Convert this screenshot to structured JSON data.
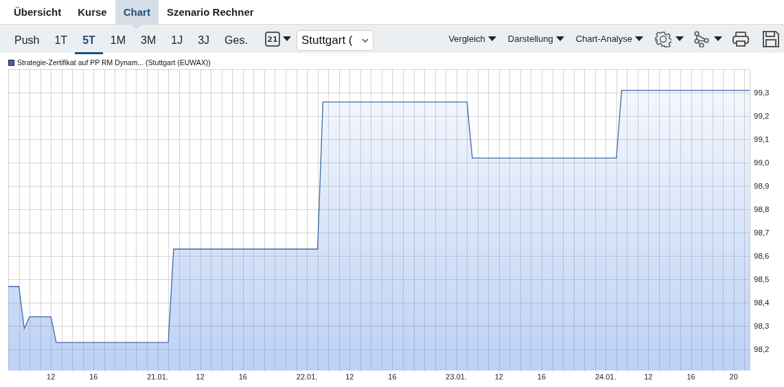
{
  "tabs": [
    {
      "label": "Übersicht",
      "selected": false
    },
    {
      "label": "Kurse",
      "selected": false
    },
    {
      "label": "Chart",
      "selected": true
    },
    {
      "label": "Szenario Rechner",
      "selected": false
    }
  ],
  "toolbar": {
    "periods": [
      {
        "label": "Push",
        "selected": false
      },
      {
        "label": "1T",
        "selected": false
      },
      {
        "label": "5T",
        "selected": true
      },
      {
        "label": "1M",
        "selected": false
      },
      {
        "label": "3M",
        "selected": false
      },
      {
        "label": "1J",
        "selected": false
      },
      {
        "label": "3J",
        "selected": false
      },
      {
        "label": "Ges.",
        "selected": false
      }
    ],
    "calendar_day": "21",
    "exchange_select": "Stuttgart (",
    "menus": [
      "Vergleich",
      "Darstellung",
      "Chart-Analyse"
    ]
  },
  "chart": {
    "chart_data": {
      "type": "area",
      "grid": true,
      "categories": [
        null,
        null,
        null,
        null,
        null,
        null,
        null,
        null,
        "12",
        null,
        null,
        null,
        null,
        null,
        null,
        null,
        "16",
        null,
        null,
        null,
        null,
        null,
        null,
        null,
        null,
        null,
        null,
        null,
        "21.01.",
        null,
        null,
        null,
        null,
        null,
        null,
        null,
        "12",
        null,
        null,
        null,
        null,
        null,
        null,
        null,
        "16",
        null,
        null,
        null,
        null,
        null,
        null,
        null,
        null,
        null,
        null,
        null,
        "22.01.",
        null,
        null,
        null,
        null,
        null,
        null,
        null,
        "12",
        null,
        null,
        null,
        null,
        null,
        null,
        null,
        "16",
        null,
        null,
        null,
        null,
        null,
        null,
        null,
        null,
        null,
        null,
        null,
        "23.01.",
        null,
        null,
        null,
        null,
        null,
        null,
        null,
        "12",
        null,
        null,
        null,
        null,
        null,
        null,
        null,
        "16",
        null,
        null,
        null,
        null,
        null,
        null,
        null,
        null,
        null,
        null,
        null,
        "24.01.",
        null,
        null,
        null,
        null,
        null,
        null,
        null,
        "12",
        null,
        null,
        null,
        null,
        null,
        null,
        null,
        "16",
        null,
        null,
        null,
        null,
        null,
        null,
        null,
        "20",
        null,
        null,
        null
      ],
      "series": [
        {
          "name": "Strategie-Zertifikat auf PP RM Dynam... (Stuttgart (EUWAX))",
          "color": "#3c68a8",
          "values": [
            98.47,
            98.47,
            98.47,
            98.29,
            98.34,
            98.34,
            98.34,
            98.34,
            98.34,
            98.23,
            98.23,
            98.23,
            98.23,
            98.23,
            98.23,
            98.23,
            98.23,
            98.23,
            98.23,
            98.23,
            98.23,
            98.23,
            98.23,
            98.23,
            98.23,
            98.23,
            98.23,
            98.23,
            98.23,
            98.23,
            98.23,
            98.63,
            98.63,
            98.63,
            98.63,
            98.63,
            98.63,
            98.63,
            98.63,
            98.63,
            98.63,
            98.63,
            98.63,
            98.63,
            98.63,
            98.63,
            98.63,
            98.63,
            98.63,
            98.63,
            98.63,
            98.63,
            98.63,
            98.63,
            98.63,
            98.63,
            98.63,
            98.63,
            98.63,
            99.26,
            99.26,
            99.26,
            99.26,
            99.26,
            99.26,
            99.26,
            99.26,
            99.26,
            99.26,
            99.26,
            99.26,
            99.26,
            99.26,
            99.26,
            99.26,
            99.26,
            99.26,
            99.26,
            99.26,
            99.26,
            99.26,
            99.26,
            99.26,
            99.26,
            99.26,
            99.26,
            99.26,
            99.02,
            99.02,
            99.02,
            99.02,
            99.02,
            99.02,
            99.02,
            99.02,
            99.02,
            99.02,
            99.02,
            99.02,
            99.02,
            99.02,
            99.02,
            99.02,
            99.02,
            99.02,
            99.02,
            99.02,
            99.02,
            99.02,
            99.02,
            99.02,
            99.02,
            99.02,
            99.02,
            99.02,
            99.31,
            99.31,
            99.31,
            99.31,
            99.31,
            99.31,
            99.31,
            99.31,
            99.31,
            99.31,
            99.31,
            99.31,
            99.31,
            99.31,
            99.31,
            99.31,
            99.31,
            99.31,
            99.31,
            99.31,
            99.31,
            99.31,
            99.31,
            99.31,
            99.31
          ]
        }
      ],
      "ylim": [
        98.11,
        99.4
      ],
      "yticks": [
        {
          "value": 98.2,
          "label": "98,2"
        },
        {
          "value": 98.3,
          "label": "98,3"
        },
        {
          "value": 98.4,
          "label": "98,4"
        },
        {
          "value": 98.5,
          "label": "98,5"
        },
        {
          "value": 98.6,
          "label": "98,6"
        },
        {
          "value": 98.7,
          "label": "98,7"
        },
        {
          "value": 98.8,
          "label": "98,8"
        },
        {
          "value": 98.9,
          "label": "98,9"
        },
        {
          "value": 99.0,
          "label": "99,0"
        },
        {
          "value": 99.1,
          "label": "99,1"
        },
        {
          "value": 99.2,
          "label": "99,2"
        },
        {
          "value": 99.3,
          "label": "99,3"
        }
      ]
    }
  }
}
